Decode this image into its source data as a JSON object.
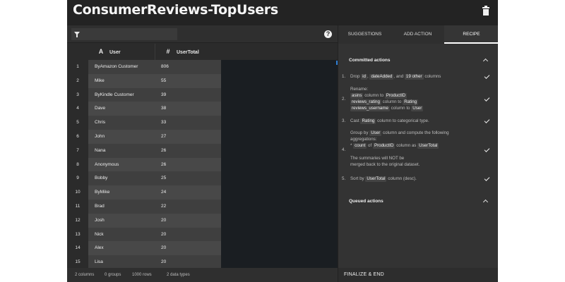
{
  "app": {
    "title": "ConsumerReviews-TopUsers"
  },
  "toolbar": {
    "filter_placeholder": "",
    "help_label": "?"
  },
  "grid": {
    "columns": [
      {
        "name": "User",
        "type_icon": "A"
      },
      {
        "name": "UserTotal",
        "type_icon": "#"
      }
    ],
    "rows": [
      {
        "index": "1",
        "user": "ByAmazon Customer",
        "total": "806"
      },
      {
        "index": "2",
        "user": "Mike",
        "total": "55"
      },
      {
        "index": "3",
        "user": "ByKindle Customer",
        "total": "39"
      },
      {
        "index": "4",
        "user": "Dave",
        "total": "38"
      },
      {
        "index": "5",
        "user": "Chris",
        "total": "33"
      },
      {
        "index": "6",
        "user": "John",
        "total": "27"
      },
      {
        "index": "7",
        "user": "Nana",
        "total": "26"
      },
      {
        "index": "8",
        "user": "Anonymous",
        "total": "26"
      },
      {
        "index": "9",
        "user": "Bobby",
        "total": "25"
      },
      {
        "index": "10",
        "user": "ByMike",
        "total": "24"
      },
      {
        "index": "11",
        "user": "Brad",
        "total": "22"
      },
      {
        "index": "12",
        "user": "Josh",
        "total": "20"
      },
      {
        "index": "13",
        "user": "Nick",
        "total": "20"
      },
      {
        "index": "14",
        "user": "Alex",
        "total": "20"
      },
      {
        "index": "15",
        "user": "Lisa",
        "total": "20"
      }
    ]
  },
  "footer": {
    "columns": "2 columns",
    "groups": "0 groups",
    "rows": "1000 rows",
    "data_types": "2 data types"
  },
  "panel": {
    "tabs": {
      "suggestions": "SUGGESTIONS",
      "add_action": "ADD ACTION",
      "recipe": "RECIPE"
    },
    "committed_title": "Committed actions",
    "queued_title": "Queued actions",
    "finalize_label": "FINALIZE & END",
    "actions": {
      "a1": {
        "num": "1.",
        "t1": "Drop",
        "tag1": "id",
        "t2": ",",
        "tag2": "dateAdded",
        "t3": ", and",
        "tag3": "19 other",
        "t4": "columns"
      },
      "a2": {
        "num": "2.",
        "t1": "Rename:",
        "tag1": "asins",
        "t2": "column to",
        "tag2": "ProductID",
        "tag3": "reviews_rating",
        "t3": "column to",
        "tag4": "Rating",
        "tag5": "reviews_username",
        "t4": "column to",
        "tag6": "User"
      },
      "a3": {
        "num": "3.",
        "t1": "Cast",
        "tag1": "Rating",
        "t2": "column to categorical type."
      },
      "a4": {
        "num": "4.",
        "t1": "Group by",
        "tag1": "User",
        "t2": "column and compute the following",
        "t3": "aggregations:",
        "t4": "*",
        "tag2": "count",
        "t5": "of",
        "tag3": "ProductID",
        "t6": "column as",
        "tag4": "UserTotal",
        "t7": "The summaries will NOT be",
        "t8": "merged back to the original dataset."
      },
      "a5": {
        "num": "5.",
        "t1": "Sort by",
        "tag1": "UserTotal",
        "t2": "column (desc)."
      }
    }
  },
  "icons": {
    "trash": "trash-icon",
    "filter": "filter-icon",
    "help": "help-icon",
    "check": "check-icon",
    "chevron": "chevron-up-icon"
  },
  "colors": {
    "header_bg": "#232323",
    "app_bg": "#2b2b2b",
    "panel_bg": "#333333",
    "grid_empty_bg": "#1a1e22",
    "accent_blue": "#2f7fd6"
  }
}
